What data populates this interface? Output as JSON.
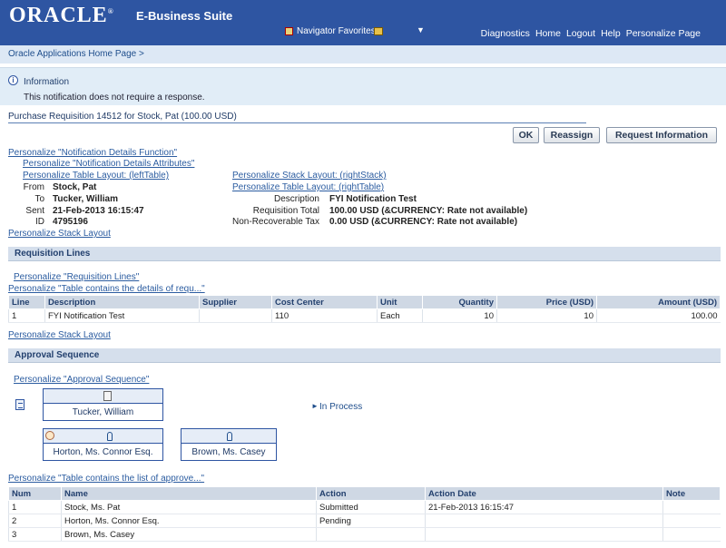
{
  "header": {
    "logo": "ORACLE",
    "suite": "E-Business Suite",
    "navigator_favorites": "Navigator Favorites",
    "global_links": [
      "Diagnostics",
      "Home",
      "Logout",
      "Help",
      "Personalize Page"
    ]
  },
  "breadcrumb": "Oracle Applications Home Page >",
  "info": {
    "title": "Information",
    "text": "This notification does not require a response."
  },
  "page_title": "Purchase Requisition 14512 for Stock, Pat (100.00 USD)",
  "buttons": {
    "ok": "OK",
    "reassign": "Reassign",
    "request_info": "Request Information"
  },
  "personalize": {
    "details_function": "Personalize \"Notification Details Function\"",
    "details_attributes": "Personalize \"Notification Details Attributes\"",
    "left_table": "Personalize Table Layout: (leftTable)",
    "right_stack": "Personalize Stack Layout: (rightStack)",
    "right_table": "Personalize Table Layout: (rightTable)",
    "stack_layout": "Personalize Stack Layout",
    "req_lines": "Personalize \"Requisition Lines\"",
    "req_table": "Personalize \"Table contains the details of requ...\"",
    "stack_layout_2": "Personalize Stack Layout",
    "approval_seq": "Personalize \"Approval Sequence\"",
    "approvers_table": "Personalize \"Table contains the list of approve...\""
  },
  "left_fields": {
    "from_label": "From",
    "from_value": "Stock, Pat",
    "to_label": "To",
    "to_value": "Tucker, William",
    "sent_label": "Sent",
    "sent_value": "21-Feb-2013 16:15:47",
    "id_label": "ID",
    "id_value": "4795196"
  },
  "right_fields": {
    "desc_label": "Description",
    "desc_value": "FYI Notification Test",
    "total_label": "Requisition Total",
    "total_value": "100.00 USD (&CURRENCY: Rate not available)",
    "tax_label": "Non-Recoverable Tax",
    "tax_value": "0.00 USD (&CURRENCY: Rate not available)"
  },
  "requisition_section": "Requisition Lines",
  "requisition_table": {
    "headers": [
      "Line",
      "Description",
      "Supplier",
      "Cost Center",
      "Unit",
      "Quantity",
      "Price (USD)",
      "Amount (USD)"
    ],
    "rows": [
      [
        "1",
        "FYI Notification Test",
        "",
        "110",
        "Each",
        "10",
        "10",
        "100.00"
      ]
    ]
  },
  "approval_section": "Approval Sequence",
  "approval_diagram": {
    "approver_1": "Tucker, William",
    "approver_2": "Horton, Ms. Connor Esq.",
    "approver_3": "Brown, Ms. Casey",
    "status": "In Process"
  },
  "approvers_table": {
    "headers": [
      "Num",
      "Name",
      "Action",
      "Action Date",
      "Note"
    ],
    "rows": [
      [
        "1",
        "Stock, Ms. Pat",
        "Submitted",
        "21-Feb-2013 16:15:47",
        ""
      ],
      [
        "2",
        "Horton, Ms. Connor Esq.",
        "Pending",
        "",
        ""
      ],
      [
        "3",
        "Brown, Ms. Casey",
        "",
        "",
        ""
      ]
    ]
  },
  "colors": {
    "header_blue": "#2e55a2",
    "link": "#2b5ca0",
    "section_bg": "#d5dfec"
  }
}
